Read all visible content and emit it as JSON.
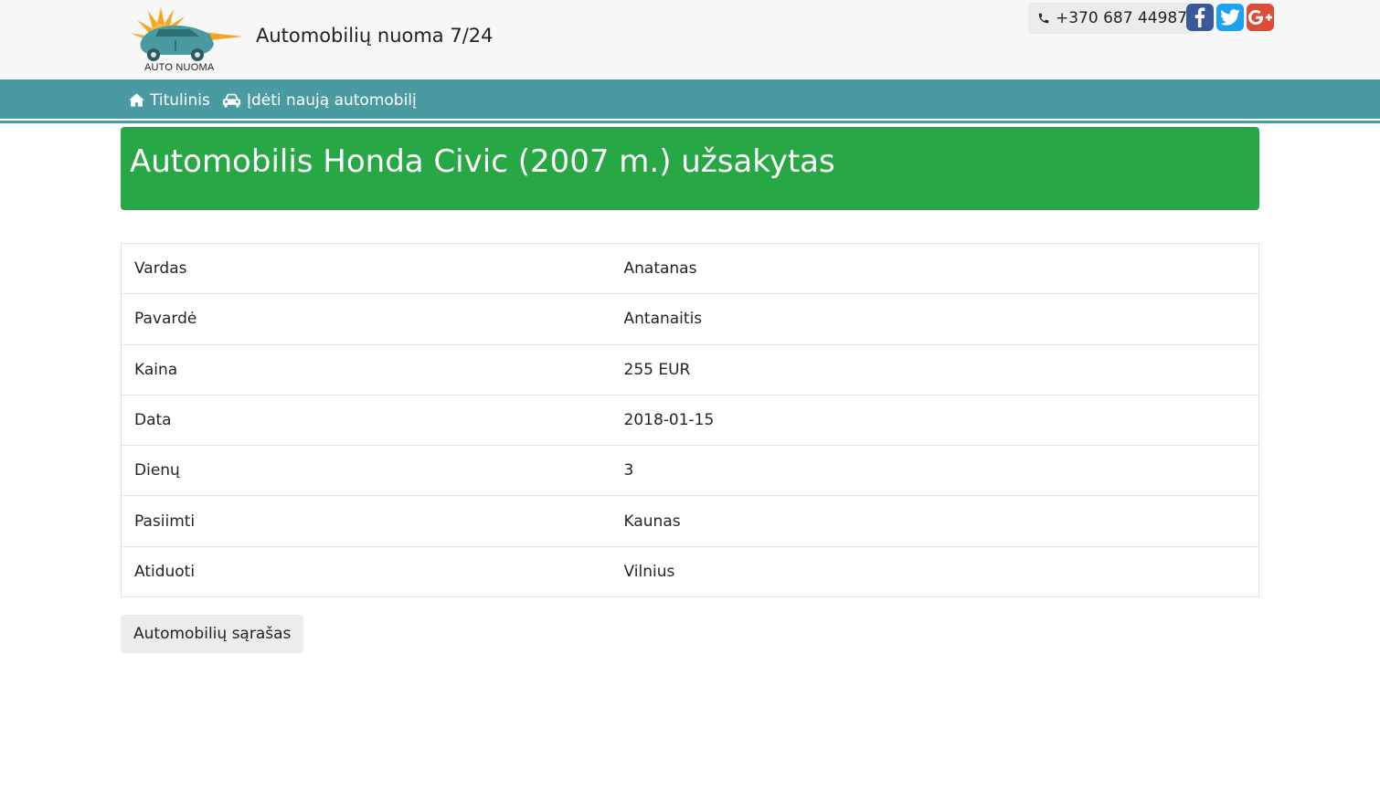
{
  "header": {
    "logo_text": "AUTO NUOMA",
    "site_title": "Automobilių nuoma 7/24",
    "phone": "+370 687 44987",
    "social": [
      "facebook-icon",
      "twitter-icon",
      "google-plus-icon"
    ]
  },
  "nav": {
    "items": [
      {
        "label": "Titulinis",
        "icon": "home-icon"
      },
      {
        "label": "Įdėti naują automobilį",
        "icon": "car-icon"
      }
    ]
  },
  "alert": {
    "text": "Automobilis Honda Civic (2007 m.) užsakytas",
    "color": "#28a745"
  },
  "details": {
    "rows": [
      {
        "key": "Vardas",
        "value": "Anatanas"
      },
      {
        "key": "Pavardė",
        "value": "Antanaitis"
      },
      {
        "key": "Kaina",
        "value": "255 EUR"
      },
      {
        "key": "Data",
        "value": "2018-01-15"
      },
      {
        "key": "Dienų",
        "value": "3"
      },
      {
        "key": "Pasiimti",
        "value": "Kaunas"
      },
      {
        "key": "Atiduoti",
        "value": "Vilnius"
      }
    ]
  },
  "actions": {
    "list_button": "Automobilių sąrašas"
  },
  "colors": {
    "navbar": "#4a9aa2",
    "header_bg": "#f7f7f7",
    "success": "#28a745"
  }
}
